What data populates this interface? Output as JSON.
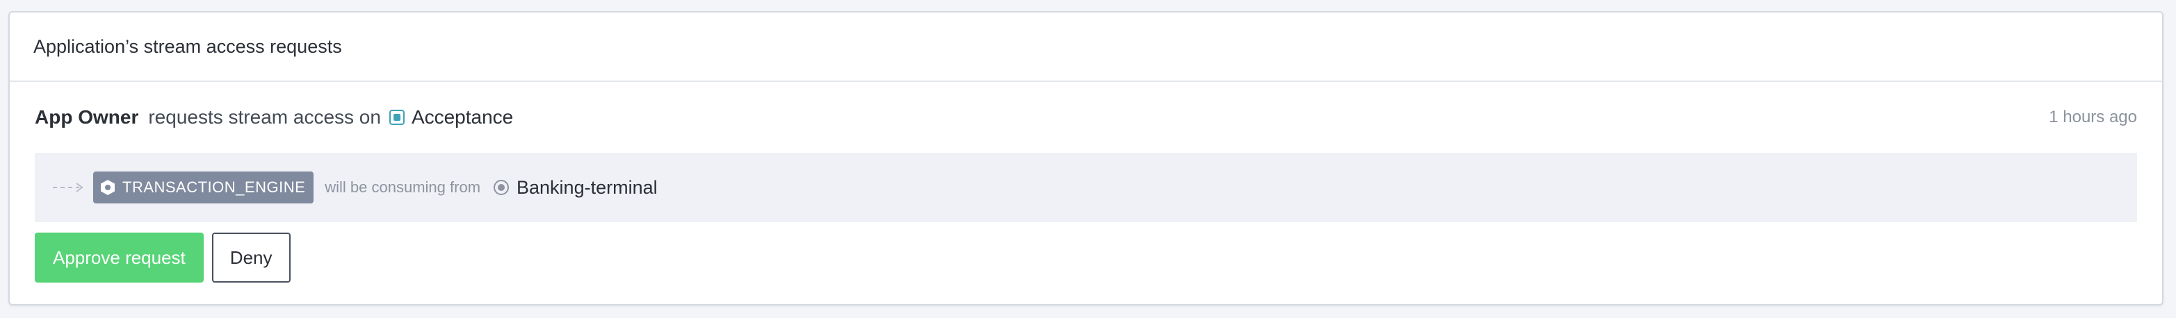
{
  "card": {
    "title": "Application’s stream access requests"
  },
  "request": {
    "requester": "App Owner",
    "action_text": "requests stream access on",
    "environment": "Acceptance",
    "time_ago": "1 hours ago"
  },
  "consumption": {
    "application": "TRANSACTION_ENGINE",
    "connector_text": "will be consuming from",
    "stream": "Banking-terminal"
  },
  "actions": {
    "approve_label": "Approve request",
    "deny_label": "Deny"
  },
  "colors": {
    "approve": "#57d477",
    "badge": "#808a9e",
    "environment_icon": "#3ea3b6",
    "row_background": "#f0f1f6"
  },
  "icons": {
    "environment": "environment-square-icon",
    "application": "hexagon-icon",
    "stream": "stream-circle-icon",
    "flow": "dashed-arrow-icon"
  }
}
